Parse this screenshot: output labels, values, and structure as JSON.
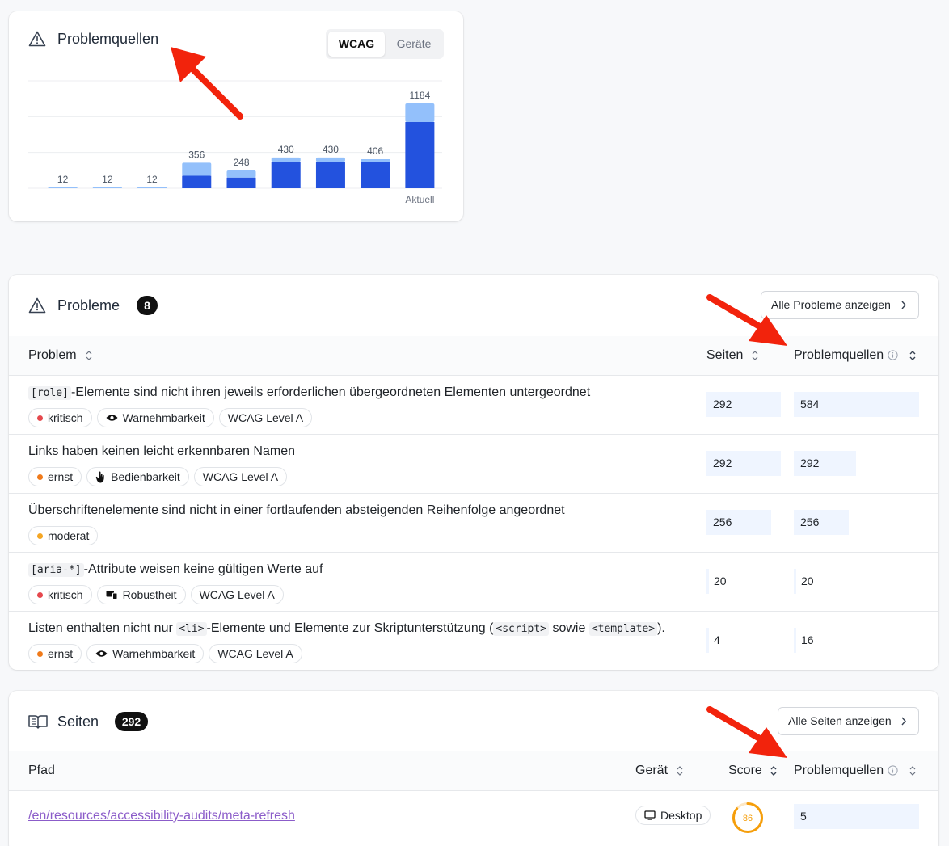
{
  "sources_card": {
    "title": "Problemquellen",
    "toggle": {
      "wcag": "WCAG",
      "devices": "Geräte",
      "active": "wcag"
    },
    "chart_data": {
      "type": "bar",
      "stacked": true,
      "categories": [
        "",
        "",
        "",
        "",
        "",
        "",
        "",
        "",
        "Aktuell"
      ],
      "totals": [
        12,
        12,
        12,
        356,
        248,
        430,
        430,
        406,
        1184
      ],
      "series": [
        {
          "values": [
            0,
            0,
            0,
            175,
            150,
            370,
            370,
            370,
            925
          ]
        },
        {
          "values": [
            12,
            12,
            12,
            181,
            98,
            60,
            60,
            36,
            259
          ]
        }
      ],
      "ylim": [
        0,
        1500
      ],
      "grid": true,
      "colors": {
        "primary": "#2352de",
        "secondary": "#93c0fb"
      }
    }
  },
  "problems_card": {
    "title": "Probleme",
    "count": "8",
    "show_all": "Alle Probleme anzeigen",
    "columns": {
      "problem": "Problem",
      "pages": "Seiten",
      "sources": "Problemquellen"
    },
    "rows": [
      {
        "pre_code": "[role]",
        "text": "-Elemente sind nicht ihren jeweils erforderlichen übergeordneten Elementen untergeordnet",
        "tags": [
          {
            "dot": "#e5484d",
            "label": "kritisch"
          },
          {
            "icon": "eye-icon",
            "label": "Warnehmbarkeit"
          },
          {
            "label": "WCAG Level A"
          }
        ],
        "pages": "292",
        "sources": "584",
        "pages_fraction": 0.5,
        "sources_fraction": 1.0
      },
      {
        "text": "Links haben keinen leicht erkennbaren Namen",
        "tags": [
          {
            "dot": "#f07a1a",
            "label": "ernst"
          },
          {
            "icon": "hand-icon",
            "label": "Bedienbarkeit"
          },
          {
            "label": "WCAG Level A"
          }
        ],
        "pages": "292",
        "sources": "292",
        "pages_fraction": 0.5,
        "sources_fraction": 0.5
      },
      {
        "text": "Überschriftenelemente sind nicht in einer fortlaufenden absteigenden Reihenfolge angeordnet",
        "tags": [
          {
            "dot": "#f5a623",
            "label": "moderat"
          }
        ],
        "pages": "256",
        "sources": "256",
        "pages_fraction": 0.44,
        "sources_fraction": 0.44
      },
      {
        "pre_code": "[aria-*]",
        "text": "-Attribute weisen keine gültigen Werte auf",
        "tags": [
          {
            "dot": "#e5484d",
            "label": "kritisch"
          },
          {
            "icon": "devices-icon",
            "label": "Robustheit"
          },
          {
            "label": "WCAG Level A"
          }
        ],
        "pages": "20",
        "sources": "20",
        "pages_fraction": 0.03,
        "sources_fraction": 0.03
      },
      {
        "text_parts": [
          "Listen enthalten nicht nur ",
          "<li>",
          "-Elemente und Elemente zur Skriptunterstützung (",
          "<script>",
          " sowie ",
          "<template>",
          ")."
        ],
        "tags": [
          {
            "dot": "#f07a1a",
            "label": "ernst"
          },
          {
            "icon": "eye-icon",
            "label": "Warnehmbarkeit"
          },
          {
            "label": "WCAG Level A"
          }
        ],
        "pages": "4",
        "sources": "16",
        "pages_fraction": 0.01,
        "sources_fraction": 0.03
      }
    ]
  },
  "pages_card": {
    "title": "Seiten",
    "count": "292",
    "show_all": "Alle Seiten anzeigen",
    "columns": {
      "path": "Pfad",
      "device": "Gerät",
      "score": "Score",
      "sources": "Problemquellen"
    },
    "rows": [
      {
        "path": "/en/resources/accessibility-audits/meta-refresh",
        "device": "Desktop",
        "score": "86",
        "score_fraction": 0.86,
        "sources": "5"
      }
    ]
  }
}
